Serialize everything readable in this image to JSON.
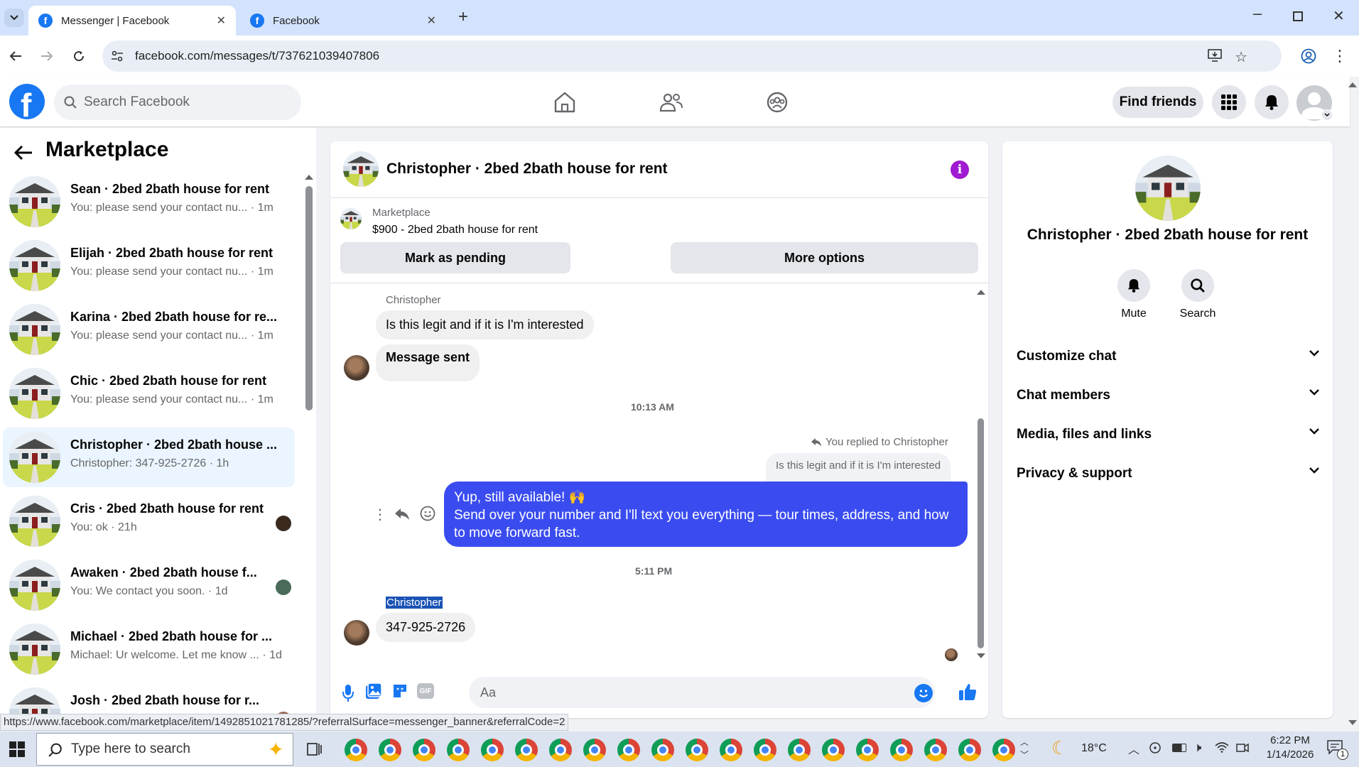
{
  "browser": {
    "tabs": [
      {
        "label": "Messenger | Facebook",
        "active": true
      },
      {
        "label": "Facebook",
        "active": false
      }
    ],
    "url": "facebook.com/messages/t/737621039407806",
    "status_url": "https://www.facebook.com/marketplace/item/1492851021781285/?referralSurface=messenger_banner&referralCode=2"
  },
  "header": {
    "search_placeholder": "Search Facebook",
    "find_friends": "Find friends"
  },
  "sidebar": {
    "title": "Marketplace",
    "conversations": [
      {
        "name": "Sean · 2bed 2bath house for rent",
        "preview": "You: please send your contact nu...",
        "time": "· 1m"
      },
      {
        "name": "Elijah · 2bed 2bath house for rent",
        "preview": "You: please send your contact nu...",
        "time": "· 1m"
      },
      {
        "name": "Karina · 2bed 2bath house for re...",
        "preview": "You: please send your contact nu...",
        "time": "· 1m"
      },
      {
        "name": "Chic · 2bed 2bath house for rent",
        "preview": "You: please send your contact nu...",
        "time": "· 1m"
      },
      {
        "name": "Christopher · 2bed 2bath house ...",
        "preview": "Christopher: 347-925-2726",
        "time": "· 1h"
      },
      {
        "name": "Cris · 2bed 2bath house for rent",
        "preview": "You: ok",
        "time": "· 21h"
      },
      {
        "name": "Awaken · 2bed 2bath house f...",
        "preview": "You: We contact you soon.",
        "time": "· 1d"
      },
      {
        "name": "Michael · 2bed 2bath house for ...",
        "preview": "Michael: Ur welcome. Let me know ...",
        "time": "· 1d"
      },
      {
        "name": "Josh · 2bed 2bath house for r...",
        "preview": "",
        "time": ""
      }
    ]
  },
  "chat": {
    "title": "Christopher · 2bed 2bath house for rent",
    "marketplace_label": "Marketplace",
    "listing": "$900 - 2bed 2bath house for rent",
    "mark_pending": "Mark as pending",
    "more_options": "More options",
    "messages": {
      "sender1": "Christopher",
      "msg1": "Is this legit and if it is I'm interested",
      "msg2": "Message sent",
      "time1": "10:13 AM",
      "replied_to": "You replied to Christopher",
      "quoted": "Is this legit and if it is I'm interested",
      "out_line1": "Yup, still available! 🙌",
      "out_line2": "Send over your number and I'll text you everything — tour times, address, and how to move forward fast.",
      "time2": "5:11 PM",
      "sender2": "Christopher",
      "msg3": "347-925-2726"
    },
    "composer_placeholder": "Aa"
  },
  "details": {
    "name": "Christopher · 2bed 2bath house for rent",
    "mute": "Mute",
    "search": "Search",
    "sections": [
      "Customize chat",
      "Chat members",
      "Media, files and links",
      "Privacy & support"
    ]
  },
  "taskbar": {
    "search_placeholder": "Type here to search",
    "temperature": "18°C",
    "time": "6:22 PM",
    "date": "1/14/2026",
    "notifications": "1"
  },
  "colors": {
    "fb_blue": "#1877f2",
    "out_bubble": "#3a4cf0",
    "info_icon": "#a01bd1"
  }
}
